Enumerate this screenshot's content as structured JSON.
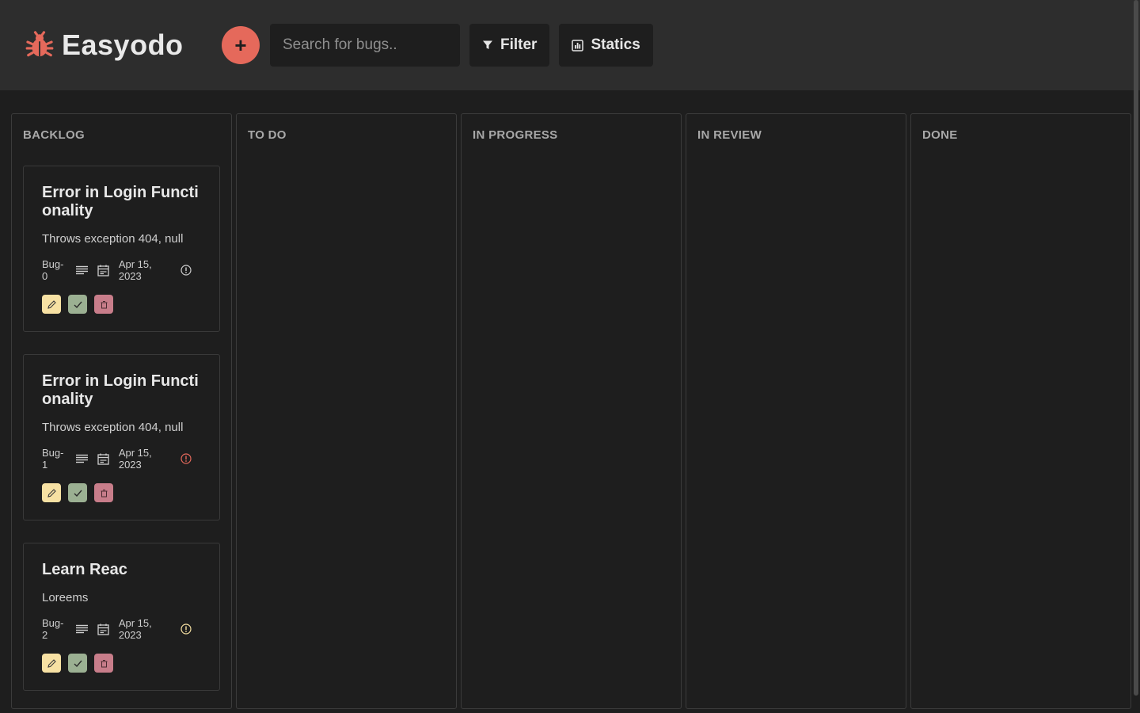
{
  "app": {
    "name": "Easyodo",
    "icon": "bug-icon",
    "accent": "#e5695b"
  },
  "toolbar": {
    "add_label": "+",
    "search_placeholder": "Search for bugs..",
    "filter_label": "Filter",
    "statics_label": "Statics"
  },
  "columns": [
    {
      "title": "BACKLOG"
    },
    {
      "title": "TO DO"
    },
    {
      "title": "IN PROGRESS"
    },
    {
      "title": "IN REVIEW"
    },
    {
      "title": "DONE"
    }
  ],
  "cards": [
    {
      "title": "Error in Login Functionality",
      "description": "Throws exception 404, null",
      "id": "Bug-0",
      "date": "Apr 15, 2023",
      "priority_color": "#cfcfcf"
    },
    {
      "title": "Error in Login Functionality",
      "description": "Throws exception 404, null",
      "id": "Bug-1",
      "date": "Apr 15, 2023",
      "priority_color": "#e5695b"
    },
    {
      "title": "Learn Reac",
      "description": "Loreems",
      "id": "Bug-2",
      "date": "Apr 15, 2023",
      "priority_color": "#f7e1a3"
    }
  ]
}
